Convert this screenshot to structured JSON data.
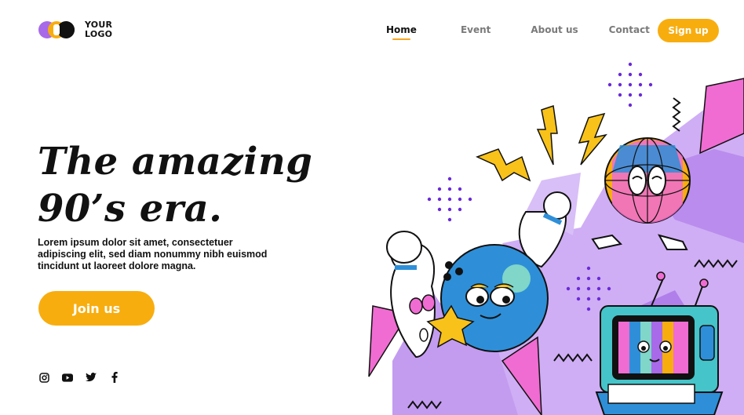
{
  "header": {
    "logo_line1": "YOUR",
    "logo_line2": "LOGO",
    "nav": [
      {
        "label": "Home",
        "active": true
      },
      {
        "label": "Event",
        "active": false
      },
      {
        "label": "About us",
        "active": false
      },
      {
        "label": "Contact",
        "active": false
      }
    ],
    "signup_label": "Sign up"
  },
  "hero": {
    "title_line1": "The amazing",
    "title_line2": "90’s era.",
    "subtitle": "Lorem ipsum dolor sit amet, consectetuer adipiscing elit, sed diam nonummy nibh euismod tincidunt ut laoreet dolore magna.",
    "cta_label": "Join us"
  },
  "social": [
    "instagram-icon",
    "youtube-icon",
    "twitter-icon",
    "facebook-icon"
  ],
  "colors": {
    "accent": "#f8ad0f",
    "purple": "#c9a8f2",
    "blue": "#2e8fd8",
    "pink": "#f06cd2",
    "teal": "#45c4c9"
  }
}
